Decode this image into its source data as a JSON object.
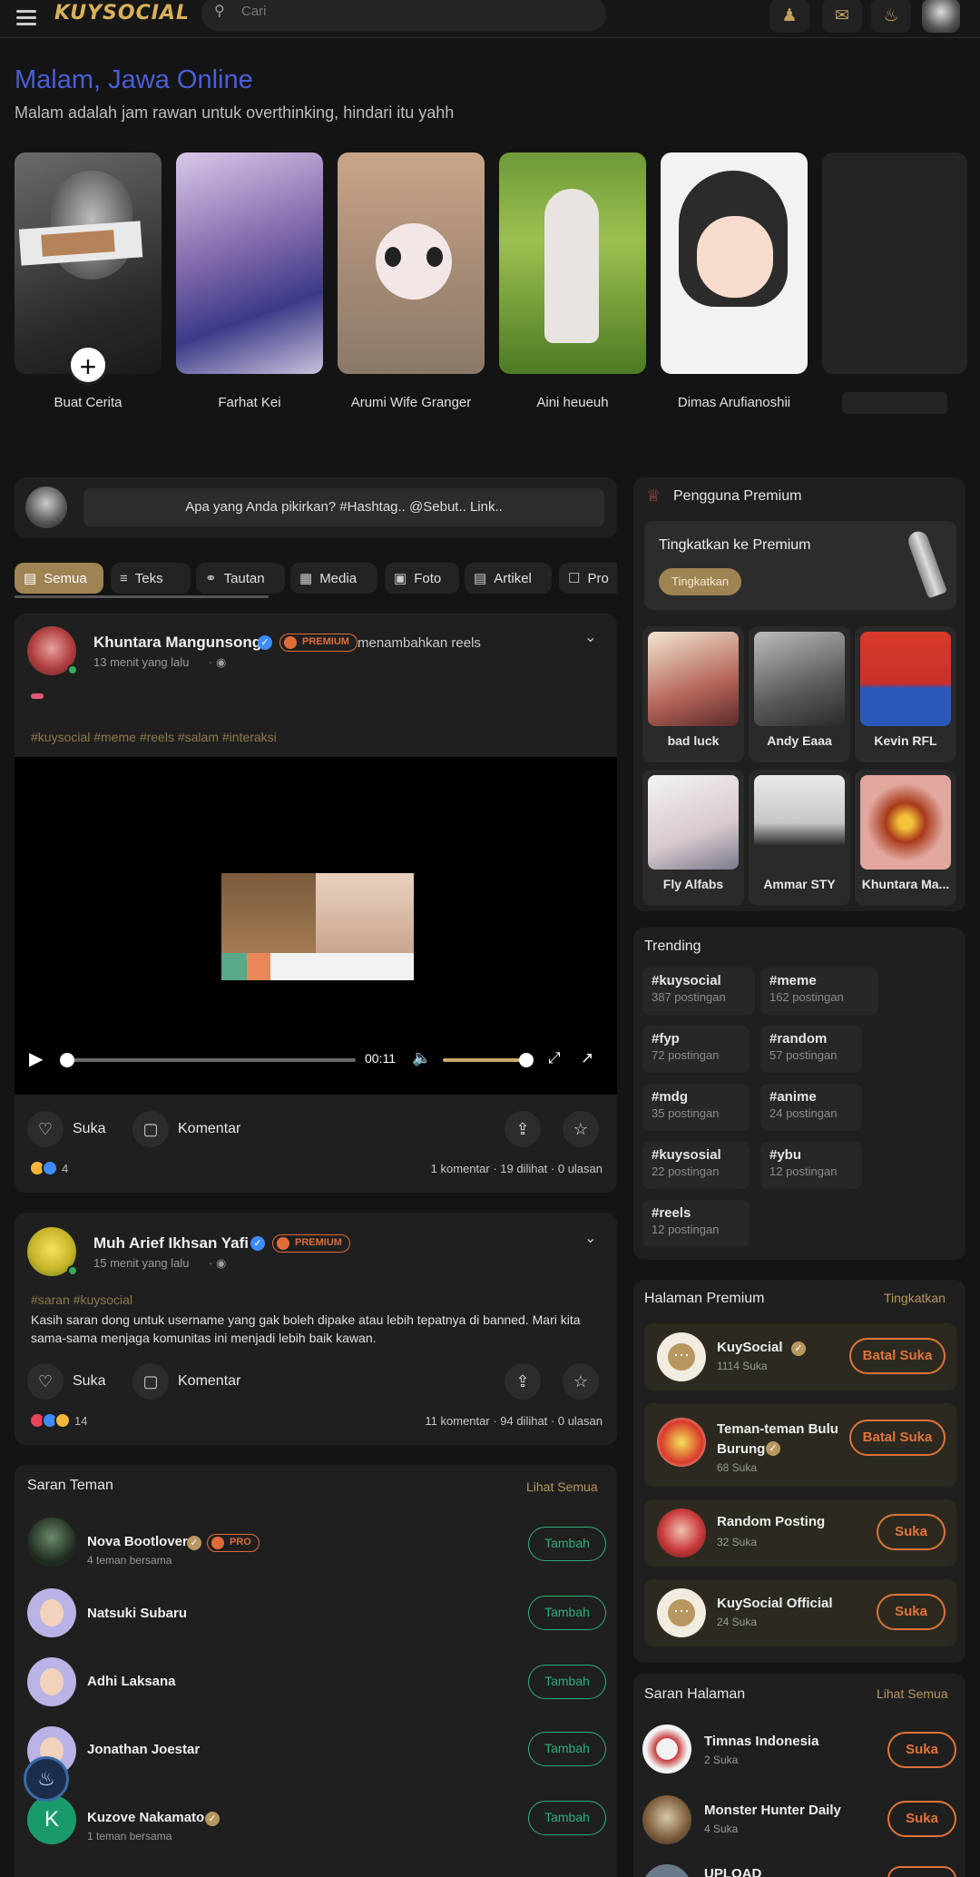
{
  "app": {
    "logo": "KUYSOCIAL"
  },
  "search": {
    "placeholder": "Cari"
  },
  "greeting": {
    "title": "Malam, Jawa Online",
    "subtitle": "Malam adalah jam rawan untuk overthinking, hindari itu yahh"
  },
  "stories": [
    {
      "name": "Buat Cerita"
    },
    {
      "name": "Farhat Kei"
    },
    {
      "name": "Arumi Wife Granger"
    },
    {
      "name": "Aini heueuh"
    },
    {
      "name": "Dimas Arufianoshii"
    }
  ],
  "composer": {
    "placeholder": "Apa yang Anda pikirkan? #Hashtag.. @Sebut.. Link.."
  },
  "tabs": [
    "Semua",
    "Teks",
    "Tautan",
    "Media",
    "Foto",
    "Artikel",
    "Pro"
  ],
  "posts": [
    {
      "author": "Khuntara Mangunsong",
      "badge": "PREMIUM",
      "action": "menambahkan reels",
      "time": "13 menit yang lalu",
      "hashtags": "#kuysocial #meme #reels #salam #interaksi",
      "video_time": "00:11",
      "like_label": "Suka",
      "comment_label": "Komentar",
      "reaction_count": "4",
      "stats": "1 komentar · 19 dilihat · 0 ulasan"
    },
    {
      "author": "Muh Arief Ikhsan Yafi",
      "badge": "PREMIUM",
      "time": "15 menit yang lalu",
      "hashtags": "#saran #kuysocial",
      "body": "Kasih saran dong untuk username yang gak boleh dipake atau lebih tepatnya di banned. Mari kita sama-sama menjaga komunitas ini menjadi lebih baik kawan.",
      "like_label": "Suka",
      "comment_label": "Komentar",
      "reaction_count": "14",
      "stats": "11 komentar · 94 dilihat · 0 ulasan"
    }
  ],
  "friend_suggestions": {
    "title": "Saran Teman",
    "see_all": "Lihat Semua",
    "add_label": "Tambah",
    "items": [
      {
        "name": "Nova Bootlover",
        "badge": "PRO",
        "sub": "4 teman bersama"
      },
      {
        "name": "Natsuki Subaru",
        "sub": ""
      },
      {
        "name": "Adhi Laksana",
        "sub": ""
      },
      {
        "name": "Jonathan Joestar",
        "sub": ""
      },
      {
        "name": "Kuzove Nakamato",
        "sub": "1 teman bersama",
        "initial": "K"
      }
    ]
  },
  "premium_users": {
    "title": "Pengguna Premium",
    "upgrade_title": "Tingkatkan ke Premium",
    "upgrade_button": "Tingkatkan",
    "users": [
      "bad luck",
      "Andy Eaaa",
      "Kevin RFL",
      "Fly Alfabs",
      "Ammar STY",
      "Khuntara Ma..."
    ]
  },
  "trending": {
    "title": "Trending",
    "items": [
      {
        "tag": "#kuysocial",
        "count": "387 postingan"
      },
      {
        "tag": "#meme",
        "count": "162 postingan"
      },
      {
        "tag": "#fyp",
        "count": "72 postingan"
      },
      {
        "tag": "#random",
        "count": "57 postingan"
      },
      {
        "tag": "#mdg",
        "count": "35 postingan"
      },
      {
        "tag": "#anime",
        "count": "24 postingan"
      },
      {
        "tag": "#kuysosial",
        "count": "22 postingan"
      },
      {
        "tag": "#ybu",
        "count": "12 postingan"
      },
      {
        "tag": "#reels",
        "count": "12 postingan"
      }
    ]
  },
  "premium_pages": {
    "title": "Halaman Premium",
    "link": "Tingkatkan",
    "items": [
      {
        "name": "KuySocial",
        "likes": "1114 Suka",
        "button": "Batal Suka"
      },
      {
        "name": "Teman-teman Bulu Burung",
        "likes": "68 Suka",
        "button": "Batal Suka"
      },
      {
        "name": "Random Posting",
        "likes": "32 Suka",
        "button": "Suka"
      },
      {
        "name": "KuySocial Official",
        "likes": "24 Suka",
        "button": "Suka"
      }
    ]
  },
  "page_suggestions": {
    "title": "Saran Halaman",
    "see_all": "Lihat Semua",
    "items": [
      {
        "name": "Timnas Indonesia",
        "likes": "2 Suka",
        "button": "Suka"
      },
      {
        "name": "Monster Hunter Daily",
        "likes": "4 Suka",
        "button": "Suka"
      },
      {
        "name": "UPLOAD",
        "likes": "",
        "button": "Suka"
      }
    ]
  },
  "colors": {
    "accent": "#b89660",
    "greeting": "#4a5ed8",
    "add_green": "#2fae7a",
    "like_orange": "#e0733a"
  }
}
